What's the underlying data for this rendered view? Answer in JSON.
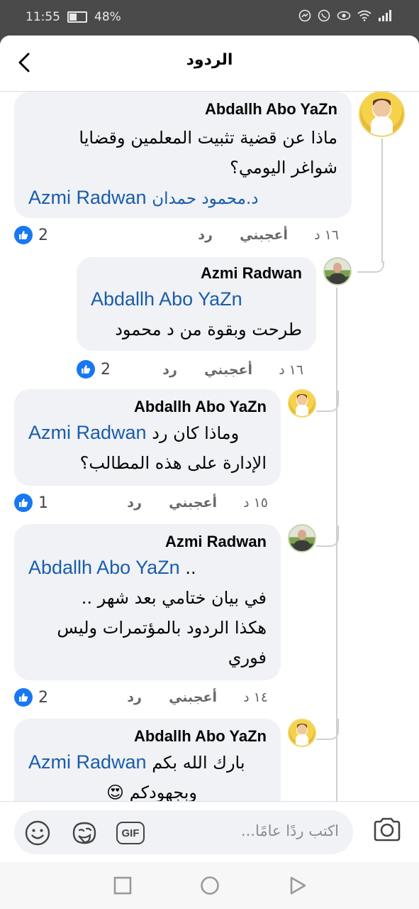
{
  "status_bar": {
    "time": "11:55",
    "battery": "48%"
  },
  "header": {
    "title": "الردود"
  },
  "comments": [
    {
      "author": "Abdallh Abo YaZn",
      "lines": [
        "ماذا عن قضية تثبيت المعلمين وقضايا",
        "شواغر اليومي؟"
      ],
      "mention_ar": "د.محمود حمدان",
      "mention": "Azmi Radwan",
      "time": "١٦ د",
      "like_label": "أعجبني",
      "reply_label": "رد",
      "reactions": "2"
    },
    {
      "author": "Azmi Radwan",
      "mention": "Abdallh Abo YaZn",
      "lines": [
        "طرحت وبقوة من د محمود"
      ],
      "time": "١٦ د",
      "like_label": "أعجبني",
      "reply_label": "رد",
      "reactions": "2"
    },
    {
      "author": "Abdallh Abo YaZn",
      "mention": "Azmi Radwan",
      "first_line_text": "وماذا كان رد",
      "lines": [
        "الإدارة على هذه المطالب؟"
      ],
      "time": "١٥ د",
      "like_label": "أعجبني",
      "reply_label": "رد",
      "reactions": "1"
    },
    {
      "author": "Azmi Radwan",
      "mention": "Abdallh Abo YaZn",
      "first_line_text": "..",
      "lines": [
        "في بيان ختامي بعد شهر ..",
        "هكذا الردود بالمؤتمرات وليس",
        "فوري"
      ],
      "time": "١٤ د",
      "like_label": "أعجبني",
      "reply_label": "رد",
      "reactions": "2"
    },
    {
      "author": "Abdallh Abo YaZn",
      "mention": "Azmi Radwan",
      "first_line_text": "بارك الله بكم",
      "lines": [
        "وبجهودكم"
      ],
      "emoji": "😍"
    }
  ],
  "composer": {
    "placeholder": "اكتب ردًا عامًا...",
    "gif_label": "GIF"
  },
  "colors": {
    "link": "#1a5cab",
    "like_blue": "#1877f2",
    "bubble": "#f0f2f5"
  }
}
